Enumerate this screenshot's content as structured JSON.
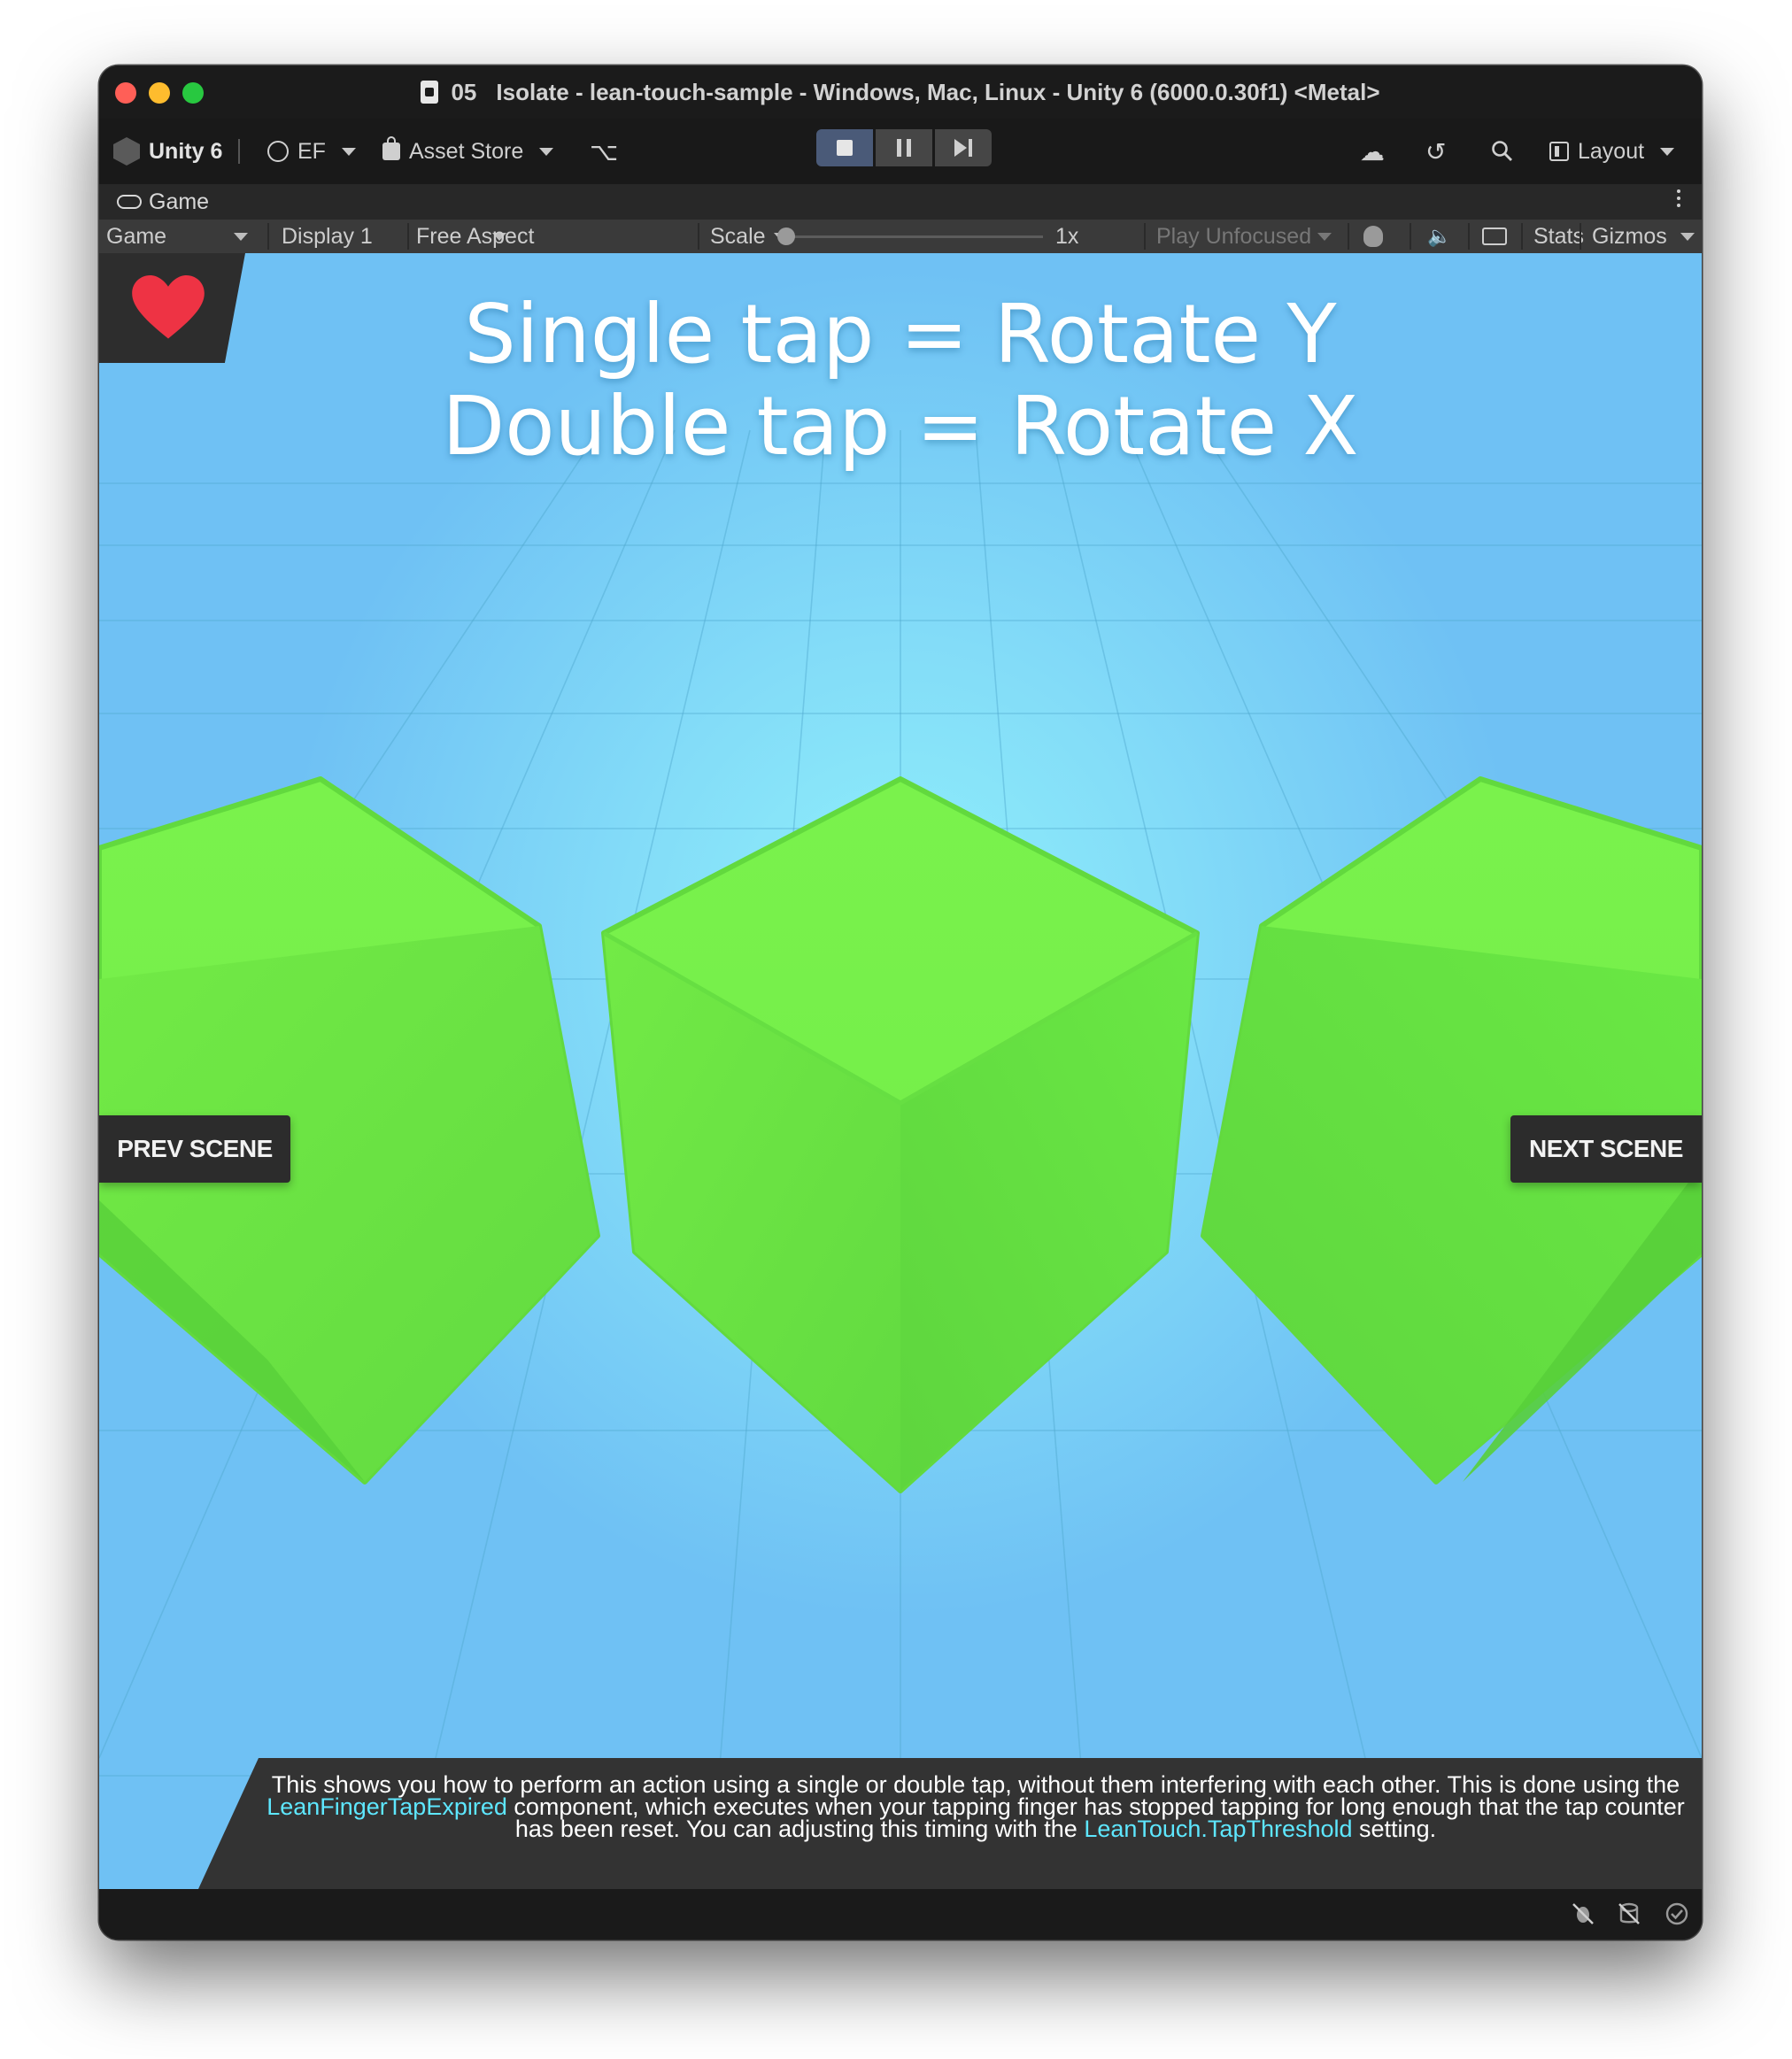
{
  "window": {
    "title_number": "05",
    "title": "Isolate - lean-touch-sample - Windows, Mac, Linux - Unity 6 (6000.0.30f1) <Metal>"
  },
  "toolbar": {
    "unity_label": "Unity 6",
    "account_label": "EF",
    "asset_store_label": "Asset Store",
    "layout_label": "Layout"
  },
  "tab": {
    "label": "Game"
  },
  "game_toolbar": {
    "view_select": "Game",
    "display_select": "Display 1",
    "aspect_select": "Free Aspect",
    "scale_label": "Scale",
    "scale_value": "1x",
    "scale_level": 0,
    "play_mode_select": "Play Unfocused",
    "stats_label": "Stats",
    "gizmos_label": "Gizmos"
  },
  "game": {
    "heading_line1": "Single tap = Rotate Y",
    "heading_line2": "Double tap = Rotate X",
    "prev_scene": "PREV SCENE",
    "next_scene": "NEXT SCENE",
    "description": {
      "part1": "This shows you how to perform an action using a single or double tap, without them interfering with each other. This is done using the ",
      "link1": "LeanFingerTapExpired",
      "part2": " component, which executes when your tapping finger has stopped tapping for long enough that the tap counter has been reset. You can adjusting this timing with the ",
      "link2": "LeanTouch.TapThreshold",
      "part3": " setting."
    }
  },
  "colors": {
    "cube_green": "#6ef04a",
    "sky_center": "#8ff0fb",
    "sky_edge": "#6fc1f4",
    "heart_red": "#ee3344",
    "link_cyan": "#5ee7ff"
  }
}
